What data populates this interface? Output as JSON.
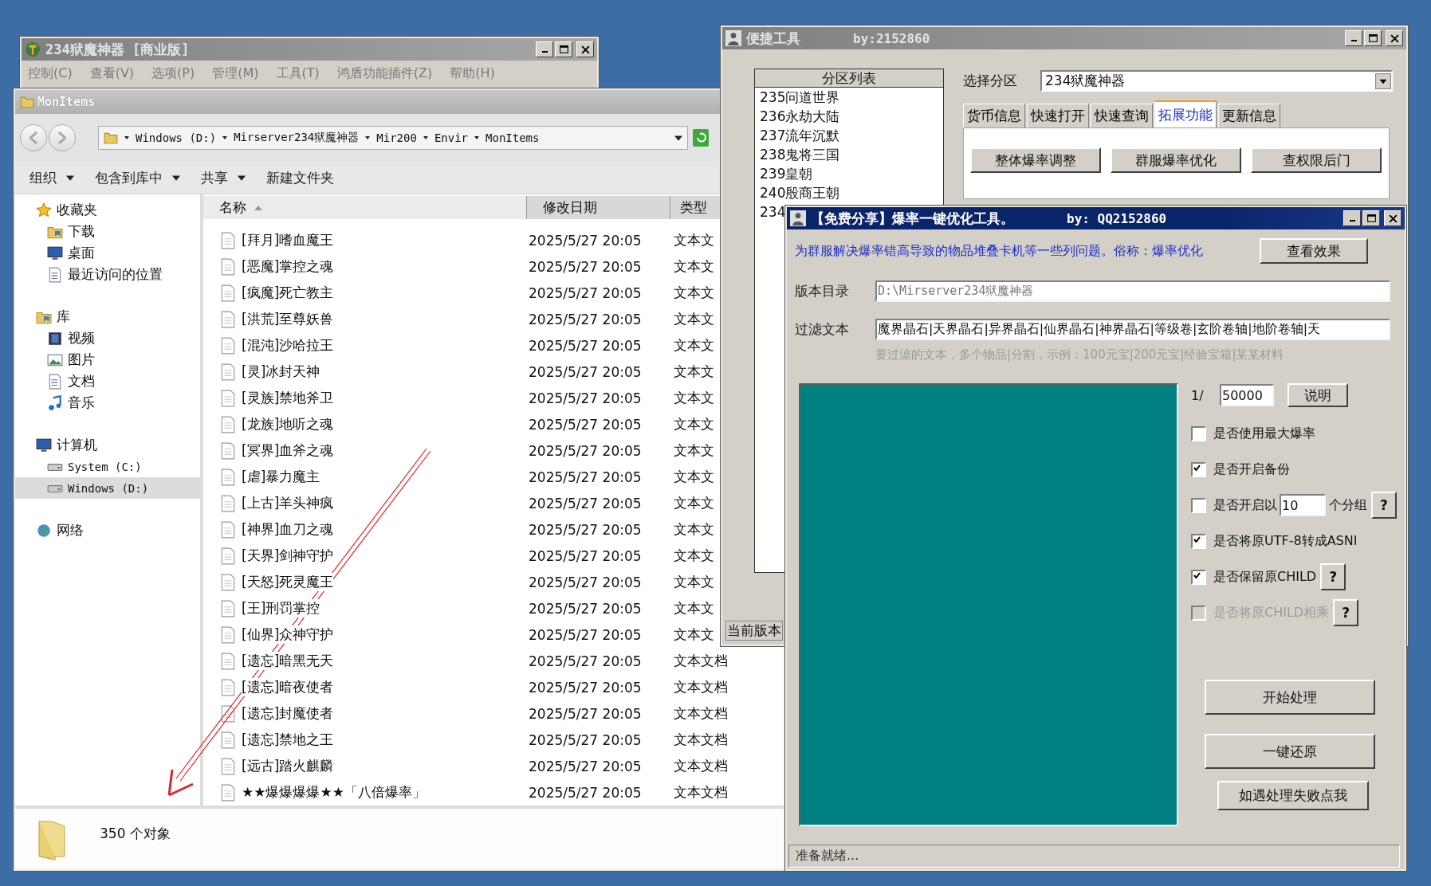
{
  "main_window": {
    "title": "234狱魔神器 [商业版]",
    "menu": [
      "控制(C)",
      "查看(V)",
      "选项(P)",
      "管理(M)",
      "工具(T)",
      "鸿盾功能插件(Z)",
      "帮助(H)"
    ]
  },
  "explorer": {
    "title": "MonItems",
    "address": [
      "Windows (D:)",
      "Mirserver234狱魔神器",
      "Mir200",
      "Envir",
      "MonItems"
    ],
    "toolbar": [
      {
        "label": "组织",
        "has_menu": true
      },
      {
        "label": "包含到库中",
        "has_menu": true
      },
      {
        "label": "共享",
        "has_menu": true
      },
      {
        "label": "新建文件夹",
        "has_menu": false
      }
    ],
    "nav": [
      {
        "label": "收藏夹",
        "selected": false,
        "children": [
          {
            "label": "下载",
            "selected": false
          },
          {
            "label": "桌面",
            "selected": false
          },
          {
            "label": "最近访问的位置",
            "selected": false
          }
        ]
      },
      {
        "label": "库",
        "selected": false,
        "children": [
          {
            "label": "视频",
            "selected": false
          },
          {
            "label": "图片",
            "selected": false
          },
          {
            "label": "文档",
            "selected": false
          },
          {
            "label": "音乐",
            "selected": false
          }
        ]
      },
      {
        "label": "计算机",
        "selected": false,
        "children": [
          {
            "label": "System (C:)",
            "selected": false
          },
          {
            "label": "Windows (D:)",
            "selected": true
          }
        ]
      },
      {
        "label": "网络",
        "selected": false
      }
    ],
    "columns": [
      {
        "label": "名称",
        "sorted": true
      },
      {
        "label": "修改日期",
        "sorted": false
      },
      {
        "label": "类型",
        "sorted": false
      }
    ],
    "rows": [
      {
        "name": "[拜月]嗜血魔王",
        "modified": "2025/5/27 20:05",
        "type": "文本文"
      },
      {
        "name": "[恶魔]掌控之魂",
        "modified": "2025/5/27 20:05",
        "type": "文本文"
      },
      {
        "name": "[疯魔]死亡教主",
        "modified": "2025/5/27 20:05",
        "type": "文本文"
      },
      {
        "name": "[洪荒]至尊妖兽",
        "modified": "2025/5/27 20:05",
        "type": "文本文"
      },
      {
        "name": "[混沌]沙哈拉王",
        "modified": "2025/5/27 20:05",
        "type": "文本文"
      },
      {
        "name": "[灵]冰封天神",
        "modified": "2025/5/27 20:05",
        "type": "文本文"
      },
      {
        "name": "[灵族]禁地斧卫",
        "modified": "2025/5/27 20:05",
        "type": "文本文"
      },
      {
        "name": "[龙族]地听之魂",
        "modified": "2025/5/27 20:05",
        "type": "文本文"
      },
      {
        "name": "[冥界]血斧之魂",
        "modified": "2025/5/27 20:05",
        "type": "文本文"
      },
      {
        "name": "[虐]暴力魔主",
        "modified": "2025/5/27 20:05",
        "type": "文本文"
      },
      {
        "name": "[上古]羊头神疯",
        "modified": "2025/5/27 20:05",
        "type": "文本文"
      },
      {
        "name": "[神界]血刀之魂",
        "modified": "2025/5/27 20:05",
        "type": "文本文"
      },
      {
        "name": "[天界]剑神守护",
        "modified": "2025/5/27 20:05",
        "type": "文本文"
      },
      {
        "name": "[天怒]死灵魔王",
        "modified": "2025/5/27 20:05",
        "type": "文本文"
      },
      {
        "name": "[王]刑罚掌控",
        "modified": "2025/5/27 20:05",
        "type": "文本文"
      },
      {
        "name": "[仙界]众神守护",
        "modified": "2025/5/27 20:05",
        "type": "文本文"
      },
      {
        "name": "[遗忘]暗黑无天",
        "modified": "2025/5/27 20:05",
        "type": "文本文档"
      },
      {
        "name": "[遗忘]暗夜使者",
        "modified": "2025/5/27 20:05",
        "type": "文本文档"
      },
      {
        "name": "[遗忘]封魔使者",
        "modified": "2025/5/27 20:05",
        "type": "文本文档"
      },
      {
        "name": "[遗忘]禁地之王",
        "modified": "2025/5/27 20:05",
        "type": "文本文档"
      },
      {
        "name": "[远古]踏火麒麟",
        "modified": "2025/5/27 20:05",
        "type": "文本文档"
      },
      {
        "name": "★★爆爆爆爆★★「八倍爆率」",
        "modified": "2025/5/27 20:05",
        "type": "文本文档"
      }
    ],
    "status": "350 个对象"
  },
  "tool_window": {
    "title": "便捷工具",
    "author": "by:2152860",
    "list_header": "分区列表",
    "partitions": [
      "235问道世界",
      "236永劫大陆",
      "237流年沉默",
      "238鬼将三国",
      "239皇朝",
      "240殷商王朝",
      "234"
    ],
    "select_label": "选择分区",
    "select_value": "234狱魔神器",
    "tabs": [
      {
        "label": "货币信息",
        "selected": false
      },
      {
        "label": "快速打开",
        "selected": false
      },
      {
        "label": "快速查询",
        "selected": false
      },
      {
        "label": "拓展功能",
        "selected": true
      },
      {
        "label": "更新信息",
        "selected": false
      }
    ],
    "buttons": [
      "整体爆率调整",
      "群服爆率优化",
      "查权限后门"
    ],
    "footer_label": "当前版本"
  },
  "dialog": {
    "title": "【免费分享】爆率一键优化工具。",
    "author": "by: QQ2152860",
    "description": "为群服解决爆率错高导致的物品堆叠卡机等一些列问题。俗称：爆率优化",
    "preview_button": "查看效果",
    "fields": [
      {
        "label": "版本目录",
        "value": "D:\\Mirserver234狱魔神器",
        "readonly": true
      },
      {
        "label": "过滤文本",
        "value": "魔界晶石|天界晶石|异界晶石|仙界晶石|神界晶石|等级卷|玄阶卷轴|地阶卷轴|天",
        "readonly": false
      }
    ],
    "hint": "要过滤的文本，多个物品|分割，示例：100元宝|200元宝|经验宝箱|某某材料",
    "ratio_prefix": "1/",
    "ratio_value": "50000",
    "explain_button": "说明",
    "options": [
      {
        "kind": "check",
        "label": "是否使用最大爆率",
        "checked": false,
        "disabled": false
      },
      {
        "kind": "check",
        "label": "是否开启备份",
        "checked": true,
        "disabled": false
      },
      {
        "kind": "group",
        "label": "是否开启以",
        "value": "10",
        "suffix": "个分组",
        "help": "?",
        "checked": false,
        "disabled": false
      },
      {
        "kind": "check",
        "label": "是否将原UTF-8转成ASNI",
        "checked": true,
        "disabled": false
      },
      {
        "kind": "check",
        "label": "是否保留原CHILD",
        "help": "?",
        "checked": true,
        "disabled": false
      },
      {
        "kind": "check",
        "label": "是否将原CHILD相乘",
        "help": "?",
        "checked": false,
        "disabled": true
      }
    ],
    "actions": [
      "开始处理",
      "一键还原",
      "如遇处理失败点我"
    ],
    "status": "准备就绪..."
  }
}
